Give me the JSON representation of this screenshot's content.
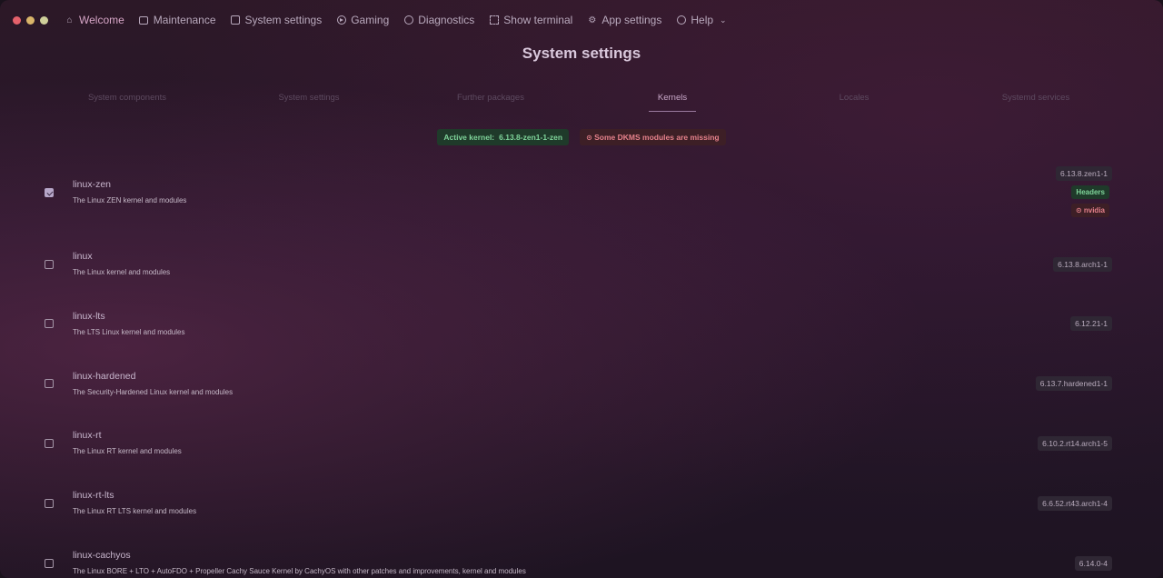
{
  "nav": {
    "items": [
      {
        "label": "Welcome",
        "icon": "home-icon"
      },
      {
        "label": "Maintenance",
        "icon": "monitor-icon"
      },
      {
        "label": "System settings",
        "icon": "settings-square-icon"
      },
      {
        "label": "Gaming",
        "icon": "gamepad-icon"
      },
      {
        "label": "Diagnostics",
        "icon": "info-icon"
      },
      {
        "label": "Show terminal",
        "icon": "terminal-icon"
      },
      {
        "label": "App settings",
        "icon": "gear-icon"
      },
      {
        "label": "Help",
        "icon": "help-icon"
      }
    ]
  },
  "page": {
    "title": "System settings"
  },
  "tabs": [
    {
      "label": "System components"
    },
    {
      "label": "System settings"
    },
    {
      "label": "Further packages"
    },
    {
      "label": "Kernels"
    },
    {
      "label": "Locales"
    },
    {
      "label": "Systemd services"
    }
  ],
  "status": {
    "active_kernel_label": "Active kernel:",
    "active_kernel_value": "6.13.8-zen1-1-zen",
    "dkms_warning": "Some DKMS modules are missing"
  },
  "kernels": [
    {
      "name": "linux-zen",
      "description": "The Linux ZEN kernel and modules",
      "version": "6.13.8.zen1-1",
      "checked": true,
      "headers": "Headers",
      "nvidia": "nvidia"
    },
    {
      "name": "linux",
      "description": "The Linux kernel and modules",
      "version": "6.13.8.arch1-1",
      "checked": false
    },
    {
      "name": "linux-lts",
      "description": "The LTS Linux kernel and modules",
      "version": "6.12.21-1",
      "checked": false
    },
    {
      "name": "linux-hardened",
      "description": "The Security-Hardened Linux kernel and modules",
      "version": "6.13.7.hardened1-1",
      "checked": false
    },
    {
      "name": "linux-rt",
      "description": "The Linux RT kernel and modules",
      "version": "6.10.2.rt14.arch1-5",
      "checked": false
    },
    {
      "name": "linux-rt-lts",
      "description": "The Linux RT LTS kernel and modules",
      "version": "6.6.52.rt43.arch1-4",
      "checked": false
    },
    {
      "name": "linux-cachyos",
      "description": "The Linux BORE + LTO + AutoFDO + Propeller Cachy Sauce Kernel by CachyOS with other patches and improvements, kernel and modules",
      "version": "6.14.0-4",
      "checked": false
    }
  ],
  "colors": {
    "accent": "#d6a5c6",
    "success_bg": "#1f3a2a",
    "success_fg": "#7fd49a",
    "danger_bg": "#3d1f26",
    "danger_fg": "#e5818b"
  }
}
